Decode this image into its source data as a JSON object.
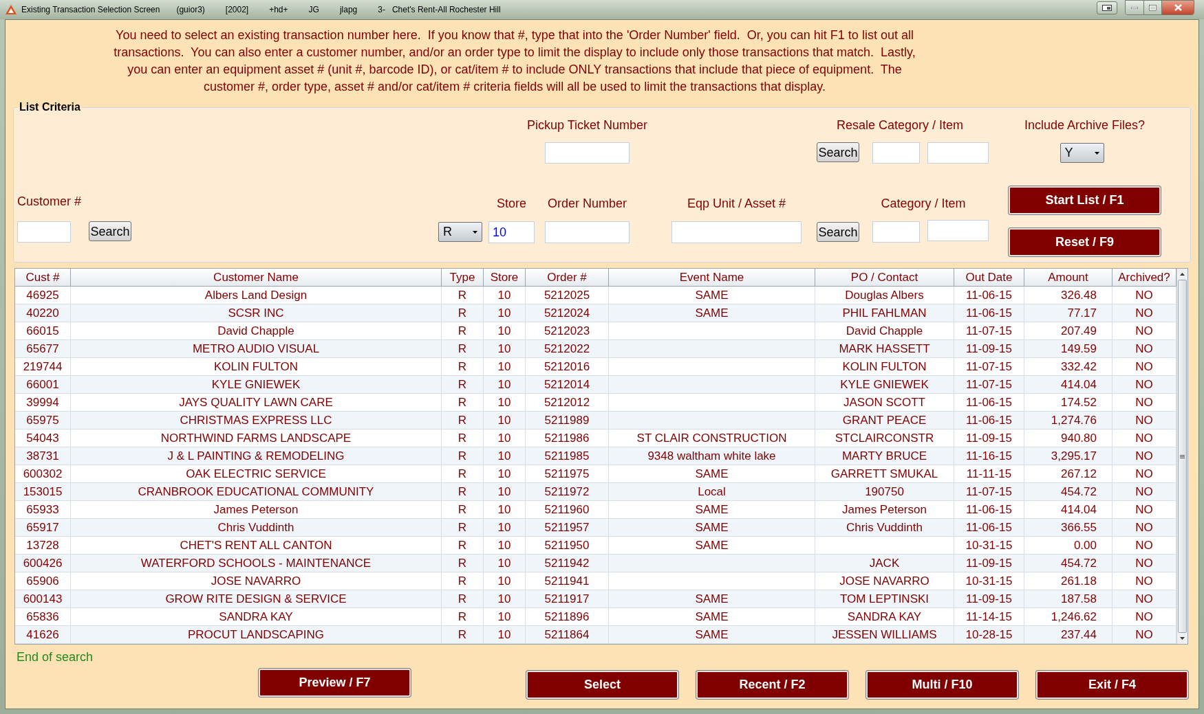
{
  "window": {
    "title": "Existing Transaction Selection Screen",
    "details": [
      "(guior3)",
      "[2002]",
      "+hd+",
      "JG",
      "jlapg",
      "3-   Chet's Rent-All Rochester Hill"
    ]
  },
  "instructions": [
    "You need to select an existing transaction number here.  If you know that #, type that into the 'Order Number' field.  Or, you can hit F1 to list out all",
    "transactions.  You can also enter a customer number, and/or an order type to limit the display to include only those transactions that match.  Lastly,",
    "you can enter an equipment asset # (unit #, barcode ID), or cat/item # to include ONLY transactions that include that piece of equipment.  The",
    "customer #, order type, asset # and/or cat/item # criteria fields will all be used to limit the transactions that display."
  ],
  "list_criteria": {
    "title": "List Criteria",
    "pickup_ticket_number": {
      "label": "Pickup Ticket Number"
    },
    "resale_category_item": {
      "label": "Resale Category / Item",
      "search_button": "Search"
    },
    "include_archive_files": {
      "label": "Include Archive Files?",
      "value": "Y"
    },
    "customer_number": {
      "label": "Customer #",
      "search_button": "Search"
    },
    "order_type": {
      "value": "R"
    },
    "store": {
      "label": "Store",
      "value": "10"
    },
    "order_number": {
      "label": "Order Number"
    },
    "eqp_unit_asset": {
      "label": "Eqp Unit / Asset #"
    },
    "category_item": {
      "label": "Category / Item",
      "search_button": "Search"
    },
    "buttons": [
      "Start List / F1",
      "Reset / F9"
    ]
  },
  "table": {
    "columns": [
      "Cust #",
      "Customer Name",
      "Type",
      "Store",
      "Order #",
      "Event Name",
      "PO / Contact",
      "Out Date",
      "Amount",
      "Archived?"
    ],
    "rows": [
      {
        "cust_no": "46925",
        "customer_name": "Albers Land Design",
        "type": "R",
        "store": "10",
        "order_no": "5212025",
        "event_name": "SAME",
        "po_contact": "Douglas Albers",
        "out_date": "11-06-15",
        "amount": "326.48",
        "archived": "NO"
      },
      {
        "cust_no": "40220",
        "customer_name": "SCSR INC",
        "type": "R",
        "store": "10",
        "order_no": "5212024",
        "event_name": "SAME",
        "po_contact": "PHIL FAHLMAN",
        "out_date": "11-06-15",
        "amount": "77.17",
        "archived": "NO"
      },
      {
        "cust_no": "66015",
        "customer_name": "David Chapple",
        "type": "R",
        "store": "10",
        "order_no": "5212023",
        "po_contact": "David Chapple",
        "out_date": "11-07-15",
        "amount": "207.49",
        "archived": "NO"
      },
      {
        "cust_no": "65677",
        "customer_name": "METRO AUDIO VISUAL",
        "type": "R",
        "store": "10",
        "order_no": "5212022",
        "po_contact": "MARK HASSETT",
        "out_date": "11-09-15",
        "amount": "149.59",
        "archived": "NO"
      },
      {
        "cust_no": "219744",
        "customer_name": "KOLIN FULTON",
        "type": "R",
        "store": "10",
        "order_no": "5212016",
        "po_contact": "KOLIN FULTON",
        "out_date": "11-07-15",
        "amount": "332.42",
        "archived": "NO"
      },
      {
        "cust_no": "66001",
        "customer_name": "KYLE GNIEWEK",
        "type": "R",
        "store": "10",
        "order_no": "5212014",
        "po_contact": "KYLE GNIEWEK",
        "out_date": "11-07-15",
        "amount": "414.04",
        "archived": "NO"
      },
      {
        "cust_no": "39994",
        "customer_name": "JAYS QUALITY LAWN CARE",
        "type": "R",
        "store": "10",
        "order_no": "5212012",
        "po_contact": "JASON SCOTT",
        "out_date": "11-06-15",
        "amount": "174.52",
        "archived": "NO"
      },
      {
        "cust_no": "65975",
        "customer_name": "CHRISTMAS EXPRESS LLC",
        "type": "R",
        "store": "10",
        "order_no": "5211989",
        "po_contact": "GRANT PEACE",
        "out_date": "11-06-15",
        "amount": "1,274.76",
        "archived": "NO"
      },
      {
        "cust_no": "54043",
        "customer_name": "NORTHWIND FARMS LANDSCAPE",
        "type": "R",
        "store": "10",
        "order_no": "5211986",
        "event_name": "ST CLAIR CONSTRUCTION",
        "po_contact": "STCLAIRCONSTR",
        "out_date": "11-09-15",
        "amount": "940.80",
        "archived": "NO"
      },
      {
        "cust_no": "38731",
        "customer_name": "J & L PAINTING & REMODELING",
        "type": "R",
        "store": "10",
        "order_no": "5211985",
        "event_name": "9348 waltham white lake",
        "po_contact": "MARTY BRUCE",
        "out_date": "11-16-15",
        "amount": "3,295.17",
        "archived": "NO"
      },
      {
        "cust_no": "600302",
        "customer_name": "OAK ELECTRIC SERVICE",
        "type": "R",
        "store": "10",
        "order_no": "5211975",
        "event_name": "SAME",
        "po_contact": "GARRETT SMUKAL",
        "out_date": "11-11-15",
        "amount": "267.12",
        "archived": "NO"
      },
      {
        "cust_no": "153015",
        "customer_name": "CRANBROOK EDUCATIONAL COMMUNITY",
        "type": "R",
        "store": "10",
        "order_no": "5211972",
        "event_name": "Local",
        "po_contact": "190750",
        "out_date": "11-07-15",
        "amount": "454.72",
        "archived": "NO"
      },
      {
        "cust_no": "65933",
        "customer_name": "James Peterson",
        "type": "R",
        "store": "10",
        "order_no": "5211960",
        "event_name": "SAME",
        "po_contact": "James Peterson",
        "out_date": "11-06-15",
        "amount": "414.04",
        "archived": "NO"
      },
      {
        "cust_no": "65917",
        "customer_name": "Chris Vuddinth",
        "type": "R",
        "store": "10",
        "order_no": "5211957",
        "event_name": "SAME",
        "po_contact": "Chris Vuddinth",
        "out_date": "11-06-15",
        "amount": "366.55",
        "archived": "NO"
      },
      {
        "cust_no": "13728",
        "customer_name": "CHET'S RENT ALL CANTON",
        "type": "R",
        "store": "10",
        "order_no": "5211950",
        "event_name": "SAME",
        "out_date": "10-31-15",
        "amount": "0.00",
        "archived": "NO"
      },
      {
        "cust_no": "600426",
        "customer_name": "WATERFORD SCHOOLS - MAINTENANCE",
        "type": "R",
        "store": "10",
        "order_no": "5211942",
        "po_contact": "JACK",
        "out_date": "11-09-15",
        "amount": "454.72",
        "archived": "NO"
      },
      {
        "cust_no": "65906",
        "customer_name": "JOSE NAVARRO",
        "type": "R",
        "store": "10",
        "order_no": "5211941",
        "po_contact": "JOSE NAVARRO",
        "out_date": "10-31-15",
        "amount": "261.18",
        "archived": "NO"
      },
      {
        "cust_no": "600143",
        "customer_name": "GROW RITE DESIGN & SERVICE",
        "type": "R",
        "store": "10",
        "order_no": "5211917",
        "event_name": "SAME",
        "po_contact": "TOM LEPTINSKI",
        "out_date": "11-09-15",
        "amount": "187.58",
        "archived": "NO"
      },
      {
        "cust_no": "65836",
        "customer_name": "SANDRA KAY",
        "type": "R",
        "store": "10",
        "order_no": "5211896",
        "event_name": "SAME",
        "po_contact": "SANDRA KAY",
        "out_date": "11-14-15",
        "amount": "1,246.62",
        "archived": "NO"
      },
      {
        "cust_no": "41626",
        "customer_name": "PROCUT LANDSCAPING",
        "type": "R",
        "store": "10",
        "order_no": "5211864",
        "event_name": "SAME",
        "po_contact": "JESSEN WILLIAMS",
        "out_date": "10-28-15",
        "amount": "237.44",
        "archived": "NO"
      }
    ]
  },
  "status": "End of search",
  "buttons": [
    "Preview / F7",
    "Select",
    "Recent / F2",
    "Multi / F10",
    "Exit / F4"
  ]
}
